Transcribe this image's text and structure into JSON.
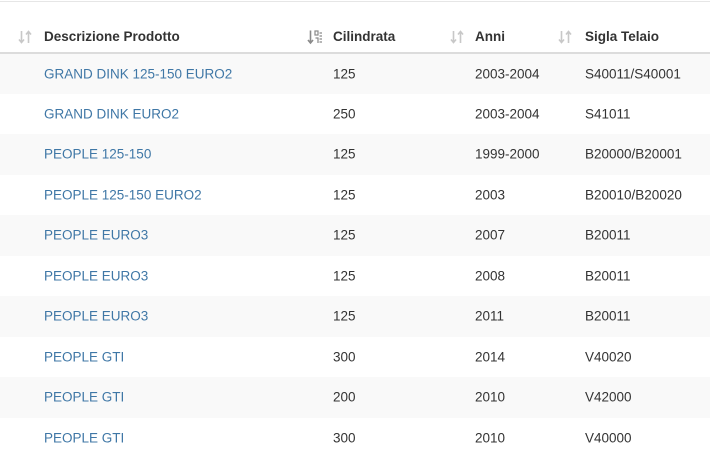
{
  "table": {
    "columns": [
      {
        "label": "Descrizione Prodotto",
        "sort": "sort-both-icon"
      },
      {
        "label": "Cilindrata",
        "sort": "sort-numeric-descending-icon"
      },
      {
        "label": "Anni",
        "sort": "sort-both-icon"
      },
      {
        "label": "Sigla Telaio",
        "sort": "sort-both-icon"
      }
    ],
    "rows": [
      {
        "descrizione": "GRAND DINK 125-150 EURO2",
        "cilindrata": "125",
        "anni": "2003-2004",
        "sigla": "S40011/S40001"
      },
      {
        "descrizione": "GRAND DINK EURO2",
        "cilindrata": "250",
        "anni": "2003-2004",
        "sigla": "S41011"
      },
      {
        "descrizione": "PEOPLE 125-150",
        "cilindrata": "125",
        "anni": "1999-2000",
        "sigla": "B20000/B20001"
      },
      {
        "descrizione": "PEOPLE 125-150 EURO2",
        "cilindrata": "125",
        "anni": "2003",
        "sigla": "B20010/B20020"
      },
      {
        "descrizione": "PEOPLE EURO3",
        "cilindrata": "125",
        "anni": "2007",
        "sigla": "B20011"
      },
      {
        "descrizione": "PEOPLE EURO3",
        "cilindrata": "125",
        "anni": "2008",
        "sigla": "B20011"
      },
      {
        "descrizione": "PEOPLE EURO3",
        "cilindrata": "125",
        "anni": "2011",
        "sigla": "B20011"
      },
      {
        "descrizione": "PEOPLE GTI",
        "cilindrata": "300",
        "anni": "2014",
        "sigla": "V40020"
      },
      {
        "descrizione": "PEOPLE GTI",
        "cilindrata": "200",
        "anni": "2010",
        "sigla": "V42000"
      },
      {
        "descrizione": "PEOPLE GTI",
        "cilindrata": "300",
        "anni": "2010",
        "sigla": "V40000"
      }
    ]
  },
  "colors": {
    "link": "#3f77a6",
    "text": "#333333",
    "row_stripe": "#f9f9f9",
    "sort_icon_inactive": "#c8c8c8",
    "sort_icon_active": "#8a8a8a"
  }
}
